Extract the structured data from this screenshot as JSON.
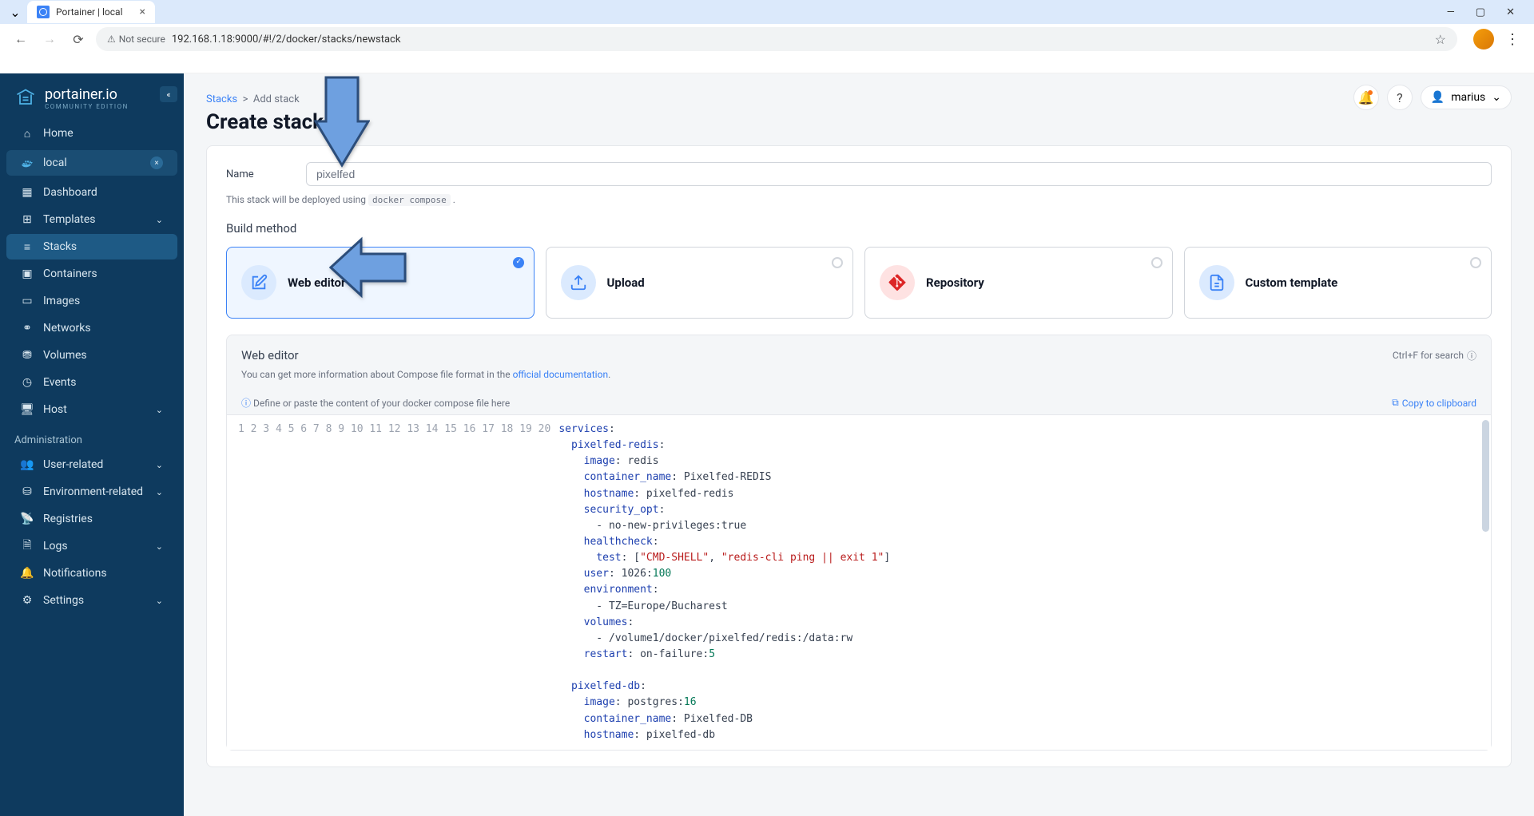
{
  "browser": {
    "tab_title": "Portainer | local",
    "security_label": "Not secure",
    "url": "192.168.1.18:9000/#!/2/docker/stacks/newstack"
  },
  "brand": {
    "name": "portainer.io",
    "sub": "COMMUNITY EDITION"
  },
  "sidebar": {
    "home": "Home",
    "env": "local",
    "items": [
      "Dashboard",
      "Templates",
      "Stacks",
      "Containers",
      "Images",
      "Networks",
      "Volumes",
      "Events",
      "Host"
    ],
    "admin_label": "Administration",
    "admin_items": [
      "User-related",
      "Environment-related",
      "Registries",
      "Logs",
      "Notifications",
      "Settings"
    ]
  },
  "header": {
    "breadcrumb_root": "Stacks",
    "breadcrumb_current": "Add stack",
    "title": "Create stack",
    "user": "marius"
  },
  "form": {
    "name_label": "Name",
    "name_value": "pixelfed",
    "deploy_note_prefix": "This stack will be deployed using ",
    "deploy_note_code": "docker compose",
    "deploy_note_suffix": " .",
    "build_method_label": "Build method",
    "methods": [
      "Web editor",
      "Upload",
      "Repository",
      "Custom template"
    ]
  },
  "editor": {
    "title": "Web editor",
    "search_hint": "Ctrl+F for search",
    "desc_prefix": "You can get more information about Compose file format in the ",
    "desc_link": "official documentation",
    "placeholder_hint": "Define or paste the content of your docker compose file here",
    "copy_label": "Copy to clipboard"
  },
  "code": {
    "lines": [
      "1",
      "2",
      "3",
      "4",
      "5",
      "6",
      "7",
      "8",
      "9",
      "10",
      "11",
      "12",
      "13",
      "14",
      "15",
      "16",
      "17",
      "18",
      "19",
      "20"
    ]
  }
}
